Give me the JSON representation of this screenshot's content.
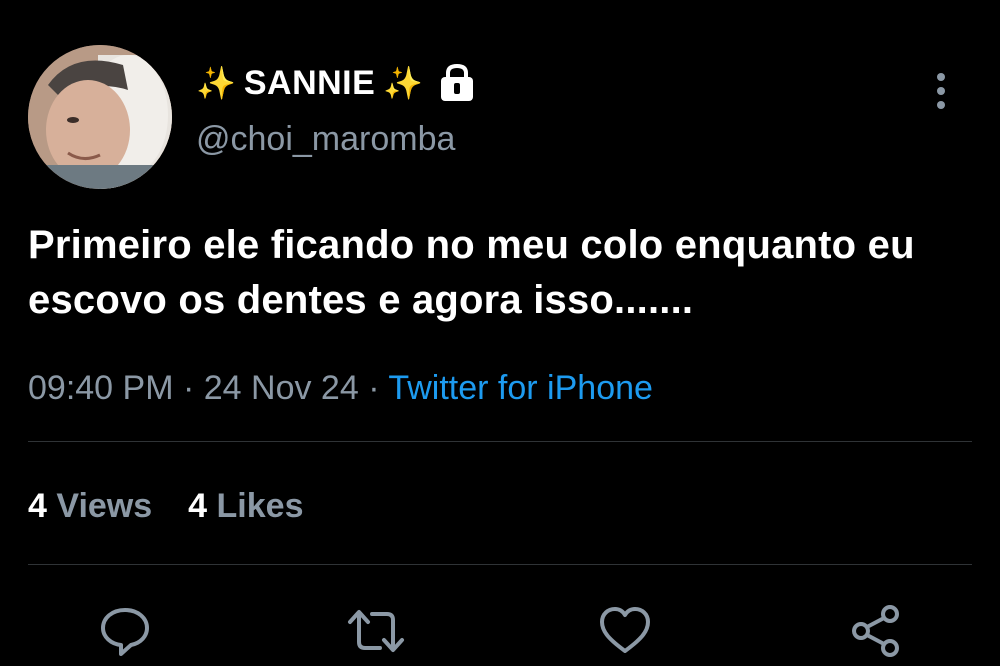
{
  "user": {
    "display_name": "SANNIE",
    "sparkle_left": "✨",
    "sparkle_right": "✨",
    "handle": "@choi_maromba",
    "avatar_icon": "profile-photo",
    "lock_icon": "lock-icon"
  },
  "tweet": {
    "text": "Primeiro ele ficando no meu colo enquanto eu escovo os dentes e agora isso.......",
    "time": "09:40 PM",
    "separator1": " · ",
    "date": "24 Nov 24",
    "separator2": " · ",
    "source": "Twitter for iPhone"
  },
  "stats": {
    "views_count": "4",
    "views_label": "Views",
    "likes_count": "4",
    "likes_label": "Likes"
  },
  "actions": {
    "reply_icon": "reply-icon",
    "retweet_icon": "retweet-icon",
    "like_icon": "heart-icon",
    "share_icon": "share-icon",
    "more_icon": "more-vertical-icon"
  },
  "colors": {
    "background": "#000000",
    "text": "#ffffff",
    "muted": "#8b98a5",
    "link": "#1d9bf0",
    "divider": "#2f3336",
    "sparkle": "#f5c518"
  }
}
